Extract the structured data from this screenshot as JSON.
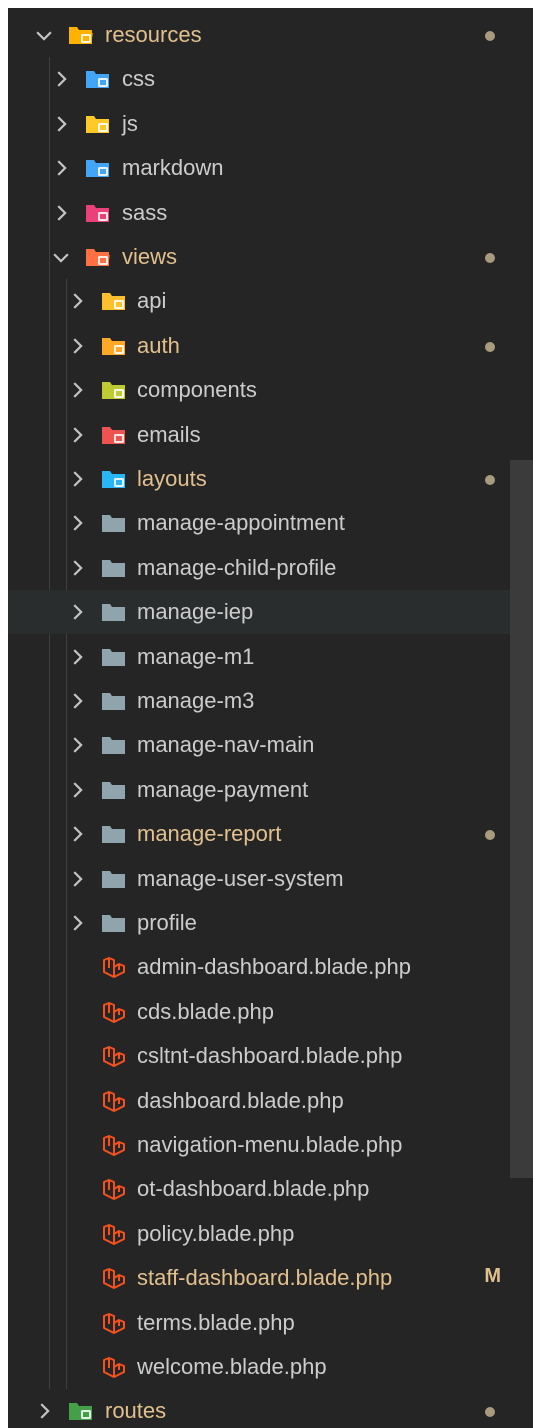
{
  "explorer": {
    "rows": [
      {
        "name": "folder-resources",
        "label": "resources",
        "depth": 0,
        "expanded": true,
        "icon": "folder-resources-icon",
        "modified": true
      },
      {
        "name": "folder-css",
        "label": "css",
        "depth": 1,
        "expanded": false,
        "icon": "folder-css-icon",
        "modified": false
      },
      {
        "name": "folder-js",
        "label": "js",
        "depth": 1,
        "expanded": false,
        "icon": "folder-js-icon",
        "modified": false
      },
      {
        "name": "folder-markdown",
        "label": "markdown",
        "depth": 1,
        "expanded": false,
        "icon": "folder-markdown-icon",
        "modified": false
      },
      {
        "name": "folder-sass",
        "label": "sass",
        "depth": 1,
        "expanded": false,
        "icon": "folder-sass-icon",
        "modified": false
      },
      {
        "name": "folder-views",
        "label": "views",
        "depth": 1,
        "expanded": true,
        "icon": "folder-views-icon",
        "modified": true
      },
      {
        "name": "folder-api",
        "label": "api",
        "depth": 2,
        "expanded": false,
        "icon": "folder-api-icon",
        "modified": false
      },
      {
        "name": "folder-auth",
        "label": "auth",
        "depth": 2,
        "expanded": false,
        "icon": "folder-auth-icon",
        "modified": true
      },
      {
        "name": "folder-components",
        "label": "components",
        "depth": 2,
        "expanded": false,
        "icon": "folder-components-icon",
        "modified": false
      },
      {
        "name": "folder-emails",
        "label": "emails",
        "depth": 2,
        "expanded": false,
        "icon": "folder-emails-icon",
        "modified": false
      },
      {
        "name": "folder-layouts",
        "label": "layouts",
        "depth": 2,
        "expanded": false,
        "icon": "folder-layouts-icon",
        "modified": true
      },
      {
        "name": "folder-manage-appointment",
        "label": "manage-appointment",
        "depth": 2,
        "expanded": false,
        "icon": "folder-icon",
        "modified": false
      },
      {
        "name": "folder-manage-child-profile",
        "label": "manage-child-profile",
        "depth": 2,
        "expanded": false,
        "icon": "folder-icon",
        "modified": false
      },
      {
        "name": "folder-manage-iep",
        "label": "manage-iep",
        "depth": 2,
        "expanded": false,
        "icon": "folder-icon",
        "modified": false,
        "hover": true
      },
      {
        "name": "folder-manage-m1",
        "label": "manage-m1",
        "depth": 2,
        "expanded": false,
        "icon": "folder-icon",
        "modified": false
      },
      {
        "name": "folder-manage-m3",
        "label": "manage-m3",
        "depth": 2,
        "expanded": false,
        "icon": "folder-icon",
        "modified": false
      },
      {
        "name": "folder-manage-nav-main",
        "label": "manage-nav-main",
        "depth": 2,
        "expanded": false,
        "icon": "folder-icon",
        "modified": false
      },
      {
        "name": "folder-manage-payment",
        "label": "manage-payment",
        "depth": 2,
        "expanded": false,
        "icon": "folder-icon",
        "modified": false
      },
      {
        "name": "folder-manage-report",
        "label": "manage-report",
        "depth": 2,
        "expanded": false,
        "icon": "folder-icon",
        "modified": true
      },
      {
        "name": "folder-manage-user-system",
        "label": "manage-user-system",
        "depth": 2,
        "expanded": false,
        "icon": "folder-icon",
        "modified": false
      },
      {
        "name": "folder-profile",
        "label": "profile",
        "depth": 2,
        "expanded": false,
        "icon": "folder-icon",
        "modified": false
      },
      {
        "name": "file-admin-dashboard",
        "label": "admin-dashboard.blade.php",
        "depth": 2,
        "file": true,
        "icon": "laravel-blade-icon"
      },
      {
        "name": "file-cds",
        "label": "cds.blade.php",
        "depth": 2,
        "file": true,
        "icon": "laravel-blade-icon"
      },
      {
        "name": "file-csltnt-dashboard",
        "label": "csltnt-dashboard.blade.php",
        "depth": 2,
        "file": true,
        "icon": "laravel-blade-icon"
      },
      {
        "name": "file-dashboard",
        "label": "dashboard.blade.php",
        "depth": 2,
        "file": true,
        "icon": "laravel-blade-icon"
      },
      {
        "name": "file-navigation-menu",
        "label": "navigation-menu.blade.php",
        "depth": 2,
        "file": true,
        "icon": "laravel-blade-icon"
      },
      {
        "name": "file-ot-dashboard",
        "label": "ot-dashboard.blade.php",
        "depth": 2,
        "file": true,
        "icon": "laravel-blade-icon"
      },
      {
        "name": "file-policy",
        "label": "policy.blade.php",
        "depth": 2,
        "file": true,
        "icon": "laravel-blade-icon"
      },
      {
        "name": "file-staff-dashboard",
        "label": "staff-dashboard.blade.php",
        "depth": 2,
        "file": true,
        "icon": "laravel-blade-icon",
        "badge": "M"
      },
      {
        "name": "file-terms",
        "label": "terms.blade.php",
        "depth": 2,
        "file": true,
        "icon": "laravel-blade-icon"
      },
      {
        "name": "file-welcome",
        "label": "welcome.blade.php",
        "depth": 2,
        "file": true,
        "icon": "laravel-blade-icon"
      },
      {
        "name": "folder-routes",
        "label": "routes",
        "depth": 0,
        "expanded": false,
        "icon": "folder-routes-icon",
        "modified": true
      }
    ]
  },
  "colors": {
    "background": "#252526",
    "text": "#cccccc",
    "modified_text": "#e2c08d",
    "modified_dot": "#b8a888",
    "hover_row": "#2a2d2e",
    "folder_default": "#90a4ae",
    "folder_resources": "#ffb300",
    "folder_css": "#42a5f5",
    "folder_js": "#ffca28",
    "folder_markdown": "#42a5f5",
    "folder_sass": "#ec407a",
    "folder_views": "#ff7043",
    "folder_api": "#fbc02d",
    "folder_auth": "#ffa726",
    "folder_components": "#c0ca33",
    "folder_emails": "#ef5350",
    "folder_layouts": "#29b6f6",
    "folder_routes": "#43a047",
    "blade": "#f4511e"
  }
}
